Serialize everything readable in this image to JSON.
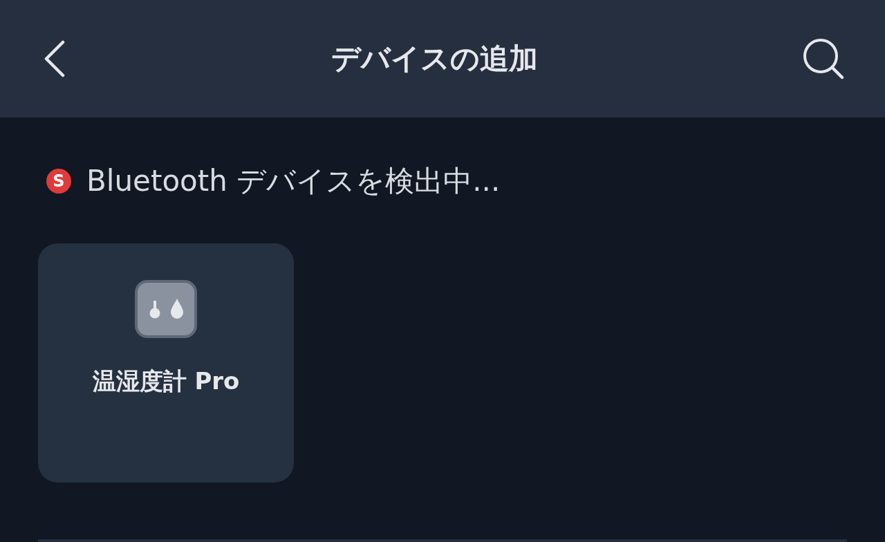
{
  "header": {
    "title": "デバイスの追加"
  },
  "scan_status": {
    "badge": "S",
    "text": "Bluetooth デバイスを検出中..."
  },
  "devices": [
    {
      "name": "温湿度計 Pro",
      "kind": "thermo-hygrometer"
    }
  ]
}
